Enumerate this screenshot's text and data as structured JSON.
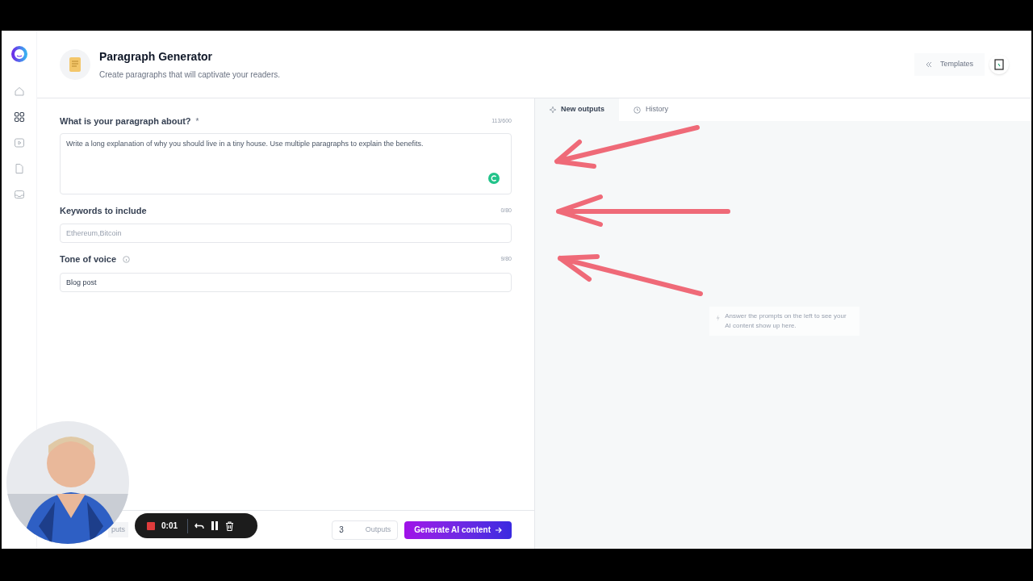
{
  "header": {
    "title": "Paragraph Generator",
    "subtitle": "Create paragraphs that will captivate your readers.",
    "templates_button": "Templates"
  },
  "sidebar": {
    "items": [
      {
        "kind": "home",
        "selected": false
      },
      {
        "kind": "apps",
        "selected": true
      },
      {
        "kind": "play",
        "selected": false
      },
      {
        "kind": "document",
        "selected": false
      },
      {
        "kind": "inbox",
        "selected": false
      }
    ]
  },
  "form": {
    "fields": [
      {
        "kind": "textarea",
        "label": "What is your paragraph about?",
        "required_mark": "*",
        "info": false,
        "counter": "113/600",
        "value": "Write a long explanation of why you should live in a tiny house. Use multiple paragraphs to explain the benefits."
      },
      {
        "kind": "input",
        "label": "Keywords to include",
        "info": false,
        "counter": "0/80",
        "placeholder": "Ethereum,Bitcoin"
      },
      {
        "kind": "input",
        "label": "Tone of voice",
        "info": true,
        "counter": "9/80",
        "value": "Blog post"
      }
    ]
  },
  "footer": {
    "hidden_button": "puts",
    "outputs_value": "3",
    "outputs_label": "Outputs",
    "generate_button": "Generate AI content"
  },
  "recorder": {
    "time": "0:01"
  },
  "output_tabs": [
    {
      "label": "New outputs",
      "selected": true
    },
    {
      "label": "History",
      "selected": false
    }
  ],
  "empty_state": "Answer the prompts on the left to see your AI content show up here."
}
